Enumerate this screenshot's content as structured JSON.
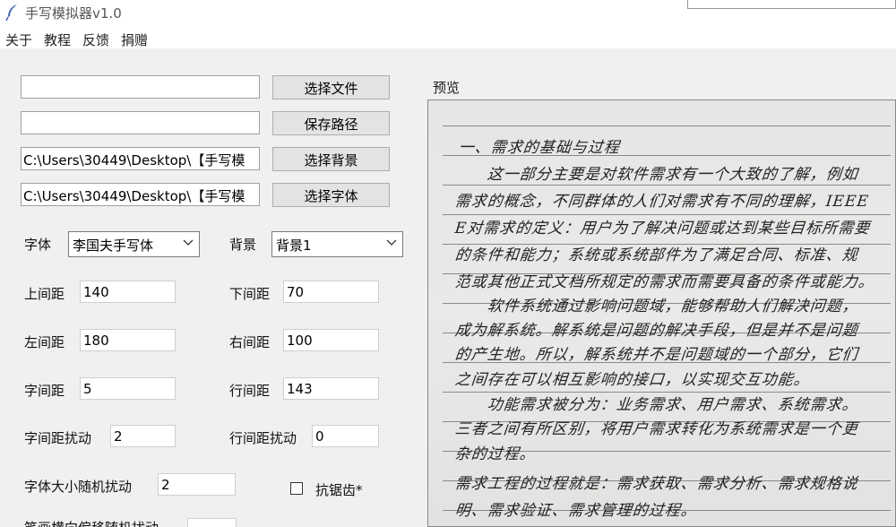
{
  "window": {
    "title": "手写模拟器v1.0",
    "icon": "feather-icon"
  },
  "menu": [
    "关于",
    "教程",
    "反馈",
    "捐赠"
  ],
  "files": {
    "text_file_value": "",
    "save_path_value": "",
    "background_path_value": "C:\\Users\\30449\\Desktop\\【手写模",
    "font_path_value": "C:\\Users\\30449\\Desktop\\【手写模",
    "select_file_label": "选择文件",
    "save_path_label": "保存路径",
    "select_background_label": "选择背景",
    "select_font_label": "选择字体"
  },
  "font": {
    "label": "字体",
    "value": "李国夫手写体"
  },
  "background": {
    "label": "背景",
    "value": "背景1"
  },
  "params": {
    "top_margin_label": "上间距",
    "top_margin": "140",
    "bottom_margin_label": "下间距",
    "bottom_margin": "70",
    "left_margin_label": "左间距",
    "left_margin": "180",
    "right_margin_label": "右间距",
    "right_margin": "100",
    "char_spacing_label": "字间距",
    "char_spacing": "5",
    "line_spacing_label": "行间距",
    "line_spacing": "143",
    "char_spacing_jitter_label": "字间距扰动",
    "char_spacing_jitter": "2",
    "line_spacing_jitter_label": "行间距扰动",
    "line_spacing_jitter": "0",
    "font_size_jitter_label": "字体大小随机扰动",
    "font_size_jitter": "2",
    "antialias_label": "抗锯齿*",
    "partial_label": "笔画横向偏移随机扰动"
  },
  "preview": {
    "label": "预览",
    "lines": [
      "一、需求的基础与过程",
      "　　这一部分主要是对软件需求有一个大致的了解，例如",
      "需求的概念，不同群体的人们对需求有不同的理解，IEEE",
      "E对需求的定义：用户为了解决问题或达到某些目标所需要",
      "的条件和能力；系统或系统部件为了满足合同、标准、规",
      "范或其他正式文档所规定的需求而需要具备的条件或能力。",
      "　　软件系统通过影响问题域，能够帮助人们解决问题，",
      "成为解系统。解系统是问题的解决手段，但是并不是问题",
      "的产生地。所以，解系统并不是问题域的一个部分，它们",
      "之间存在可以相互影响的接口，以实现交互功能。",
      "　　功能需求被分为：业务需求、用户需求、系统需求。",
      "三者之间有所区别，将用户需求转化为系统需求是一个更",
      "杂的过程。",
      "需求工程的过程就是：需求获取、需求分析、需求规格说",
      "明、需求验证、需求管理的过程。"
    ]
  }
}
